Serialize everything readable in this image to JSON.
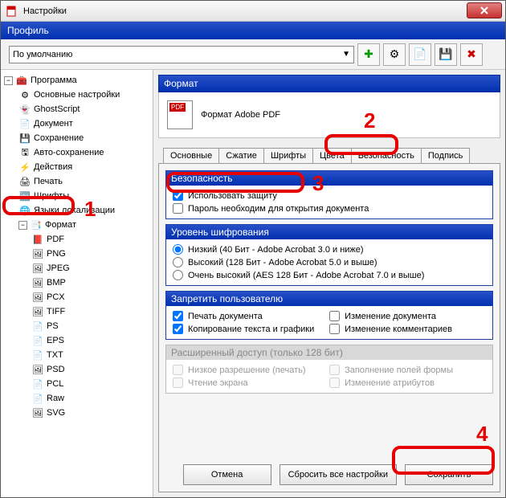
{
  "window": {
    "title": "Настройки"
  },
  "profile": {
    "bar_label": "Профиль",
    "selected": "По умолчанию"
  },
  "tree": {
    "root": "Программа",
    "items": [
      "Основные настройки",
      "GhostScript",
      "Документ",
      "Сохранение",
      "Авто-сохранение",
      "Действия",
      "Печать",
      "Шрифты",
      "Языки локализации"
    ],
    "format_label": "Формат",
    "formats": [
      "PDF",
      "PNG",
      "JPEG",
      "BMP",
      "PCX",
      "TIFF",
      "PS",
      "EPS",
      "TXT",
      "PSD",
      "PCL",
      "Raw",
      "SVG"
    ]
  },
  "panel": {
    "title": "Формат",
    "format_name": "Формат Adobe PDF"
  },
  "tabs": {
    "t0": "Основные",
    "t1": "Сжатие",
    "t2": "Шрифты",
    "t3": "Цвета",
    "t4": "Безопасность",
    "t5": "Подпись"
  },
  "security": {
    "group_title": "Безопасность",
    "use_protection": "Использовать защиту",
    "open_password": "Пароль необходим для открытия документа"
  },
  "encryption": {
    "group_title": "Уровень шифрования",
    "low": "Низкий (40 Бит - Adobe Acrobat 3.0 и ниже)",
    "high": "Высокий (128 Бит - Adobe Acrobat 5.0 и выше)",
    "aes": "Очень высокий (AES 128 Бит - Adobe Acrobat 7.0 и выше)"
  },
  "deny": {
    "group_title": "Запретить пользователю",
    "print_doc": "Печать документа",
    "change_doc": "Изменение документа",
    "copy_text": "Копирование текста и графики",
    "change_comments": "Изменение комментариев"
  },
  "advanced": {
    "group_title": "Расширенный доступ (только 128 бит)",
    "low_res": "Низкое разрешение (печать)",
    "fill_forms": "Заполнение полей формы",
    "screen_read": "Чтение экрана",
    "change_attrs": "Изменение атрибутов"
  },
  "buttons": {
    "cancel": "Отмена",
    "reset": "Сбросить все настройки",
    "save": "Сохранить"
  },
  "callouts": {
    "n1": "1",
    "n2": "2",
    "n3": "3",
    "n4": "4"
  }
}
